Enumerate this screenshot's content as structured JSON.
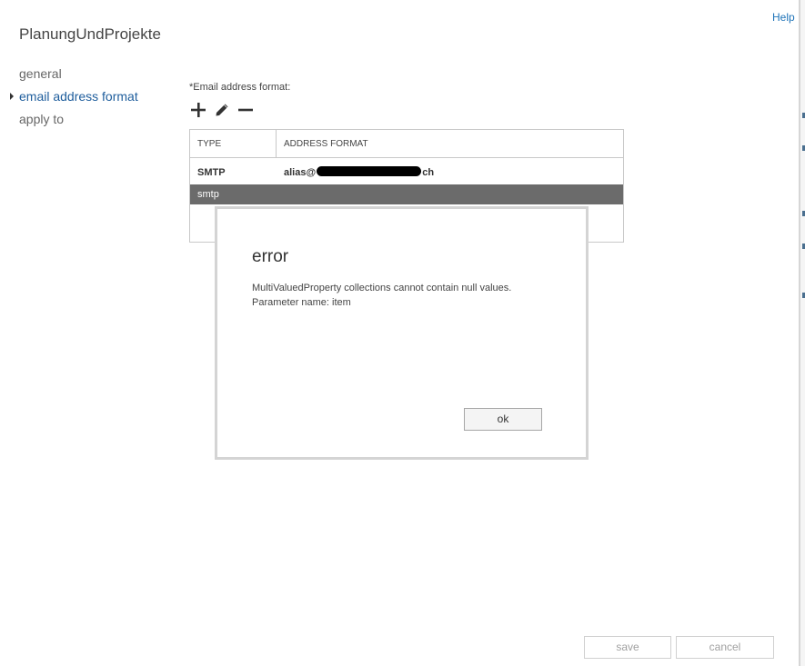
{
  "header": {
    "help_label": "Help",
    "title": "PlanungUndProjekte"
  },
  "nav": {
    "items": [
      {
        "label": "general",
        "active": false
      },
      {
        "label": "email address format",
        "active": true
      },
      {
        "label": "apply to",
        "active": false
      }
    ]
  },
  "form": {
    "email_format_label": "*Email address format:",
    "toolbar": {
      "add_icon": "plus-icon",
      "edit_icon": "pencil-icon",
      "remove_icon": "minus-icon"
    },
    "grid": {
      "columns": [
        "TYPE",
        "ADDRESS FORMAT"
      ],
      "rows": [
        {
          "type": "SMTP",
          "address_prefix": "alias@",
          "address_suffix": "ch",
          "redacted": true
        },
        {
          "type": "smtp",
          "address_prefix": "",
          "address_suffix": ""
        }
      ]
    }
  },
  "dialog": {
    "title": "error",
    "message_line1": "MultiValuedProperty collections cannot contain null values.",
    "message_line2": "Parameter name: item",
    "ok_label": "ok"
  },
  "footer": {
    "save_label": "save",
    "cancel_label": "cancel"
  },
  "colors": {
    "accent": "#1e5d9c",
    "link": "#1e73b8",
    "selected_row": "#6b6b6b"
  }
}
